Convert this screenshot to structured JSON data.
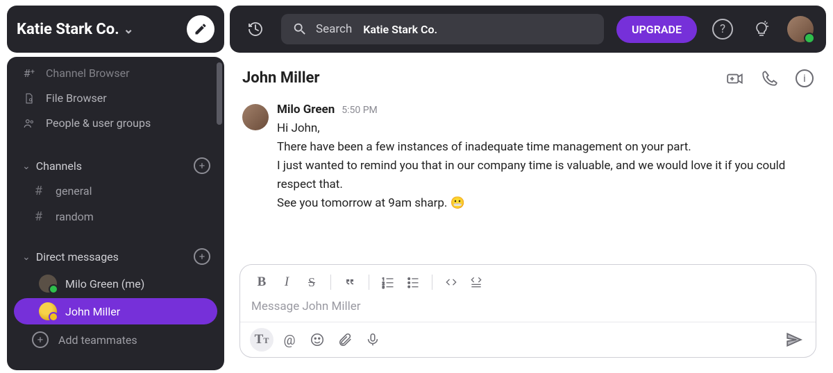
{
  "workspace": {
    "name": "Katie Stark Co."
  },
  "topbar": {
    "search_label": "Search",
    "search_scope": "Katie Stark Co.",
    "upgrade_label": "UPGRADE"
  },
  "sidebar": {
    "browser_items": [
      {
        "label": "Channel Browser"
      },
      {
        "label": "File Browser"
      },
      {
        "label": "People & user groups"
      }
    ],
    "channels_section_label": "Channels",
    "channels": [
      {
        "name": "general"
      },
      {
        "name": "random"
      }
    ],
    "dm_section_label": "Direct messages",
    "dms": [
      {
        "name": "Milo Green (me)",
        "active": false,
        "status": "online"
      },
      {
        "name": "John Miller",
        "active": true,
        "status": "away"
      }
    ],
    "add_teammates_label": "Add teammates"
  },
  "conversation": {
    "title": "John Miller",
    "message": {
      "author": "Milo Green",
      "time": "5:50 PM",
      "line1": "Hi John,",
      "line2": "There have been a few instances of inadequate time management on your part.",
      "line3": "I just wanted to remind you that in our company time is valuable, and we would love it if you could respect that.",
      "line4": "See you tomorrow at 9am sharp.",
      "emoji": "😬"
    }
  },
  "composer": {
    "placeholder": "Message John Miller"
  }
}
